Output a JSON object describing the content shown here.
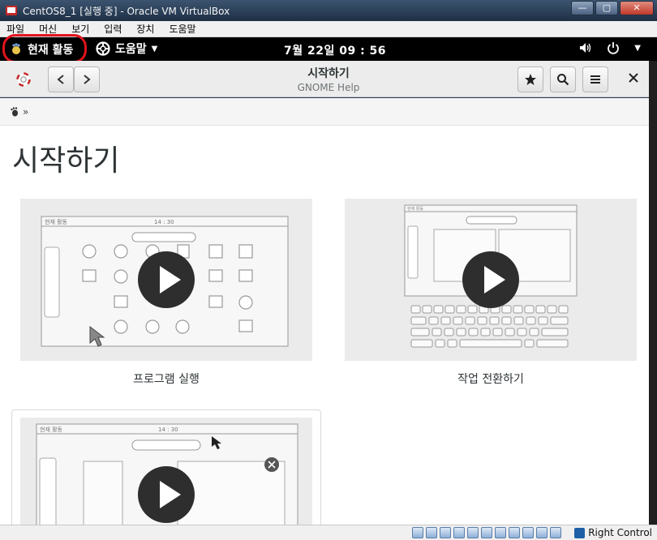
{
  "window": {
    "title": "CentOS8_1 [실행 중] - Oracle VM VirtualBox",
    "controls": {
      "minimize": "—",
      "maximize": "▢",
      "close": "✕"
    }
  },
  "vbox_menu": [
    "파일",
    "머신",
    "보기",
    "입력",
    "장치",
    "도움말"
  ],
  "gnome_topbar": {
    "activities": "현재 활동",
    "app_menu": "도움말",
    "clock": "7월 22일  09 : 56"
  },
  "headerbar": {
    "title": "시작하기",
    "subtitle": "GNOME Help"
  },
  "breadcrumb": {
    "separator": "»"
  },
  "content": {
    "page_title": "시작하기",
    "cards": [
      {
        "caption": "프로그램 실행",
        "mock_clock": "14 : 30",
        "mock_tab": "현재 활동"
      },
      {
        "caption": "작업 전환하기",
        "mock_tab": "현재 활동"
      },
      {
        "caption": "",
        "mock_clock": "14 : 30",
        "mock_tab": "현재 활동"
      }
    ]
  },
  "statusbar": {
    "host_key": "Right Control"
  },
  "colors": {
    "highlight_ring": "#e0141c",
    "topbar": "#000000",
    "accent": "#2e3436"
  }
}
